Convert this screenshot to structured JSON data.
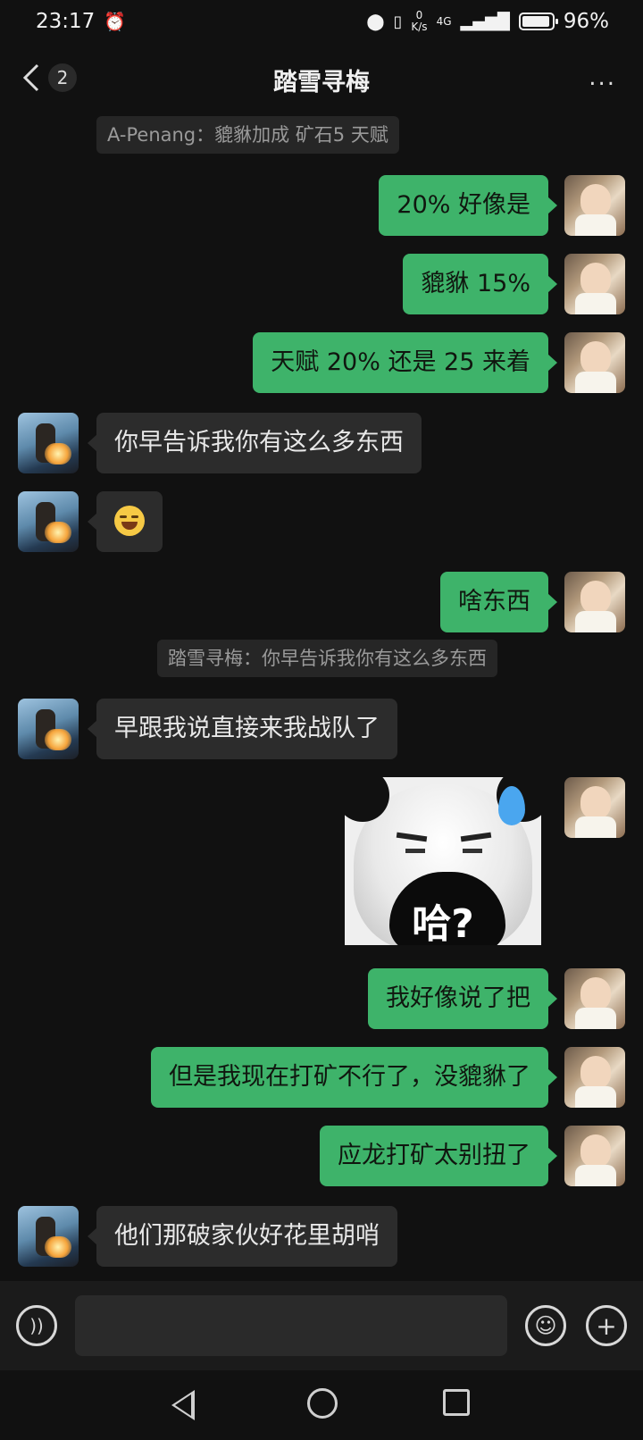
{
  "status_bar": {
    "time": "23:17",
    "net_speed_value": "0",
    "net_speed_unit": "K/s",
    "network": "4G",
    "battery": "96%"
  },
  "header": {
    "unread_count": "2",
    "title": "踏雪寻梅",
    "more_label": "..."
  },
  "messages": {
    "sys1": "A-Penang：貔貅加成 矿石5 天赋",
    "m1": "20% 好像是",
    "m2": "貔貅 15%",
    "m3": "天赋 20% 还是 25 来着",
    "o1": "你早告诉我你有这么多东西",
    "m4": "啥东西",
    "sys2": "踏雪寻梅：你早告诉我你有这么多东西",
    "o3": "早跟我说直接来我战队了",
    "sticker_caption": "哈?",
    "m5": "我好像说了把",
    "m6": "但是我现在打矿不行了，没貔貅了",
    "m7": "应龙打矿太别扭了",
    "o4": "他们那破家伙好花里胡哨"
  },
  "input": {
    "placeholder": ""
  },
  "icons": {
    "voice": "voice-icon",
    "emoji": "emoji-icon",
    "plus": "plus-icon",
    "alarm": "alarm-icon",
    "location": "location-icon",
    "vibrate": "vibrate-icon",
    "signal": "signal-icon",
    "battery": "battery-icon"
  }
}
